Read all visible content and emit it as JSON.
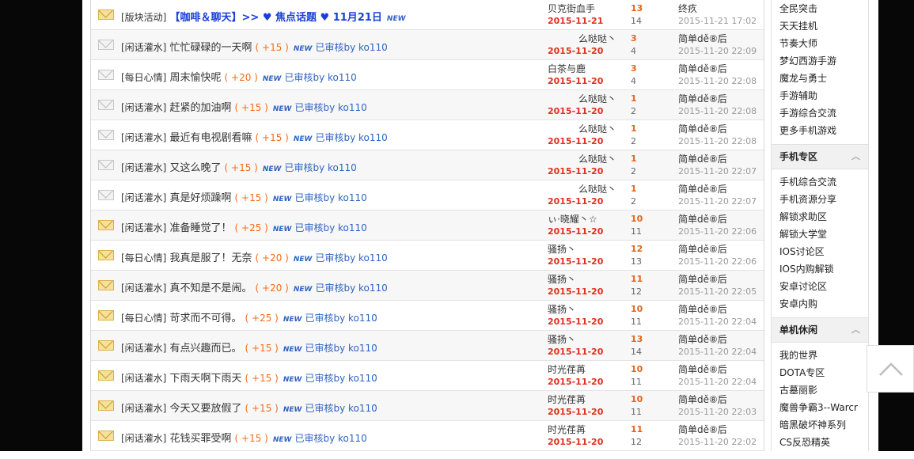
{
  "threads": [
    {
      "icon": "folder-hot-icon",
      "category": "[版块活动]",
      "title_prefix": "【咖啡＆聊天】>> ♥ 焦点话题 ♥ 11月21日",
      "title": "",
      "points": "",
      "new_badge": "NEW",
      "audit": "",
      "author": "贝克街血手",
      "author_date": "2015-11-21",
      "replies": "13",
      "views": "14",
      "last_user": "终疚",
      "last_time": "2015-11-21 17:02",
      "stripe": false,
      "hot": true,
      "author_right": false
    },
    {
      "icon": "folder-icon",
      "category": "[闲话灌水]",
      "title": "忙忙碌碌的一天啊",
      "points": "( +15 )",
      "new_badge": "NEW",
      "audit": "已审核by ko110",
      "author": "么哒哒丶",
      "author_date": "2015-11-20",
      "replies": "3",
      "views": "4",
      "last_user": "简单dě⑧后",
      "last_time": "2015-11-20 22:09",
      "stripe": true,
      "hot": false,
      "author_right": true
    },
    {
      "icon": "folder-icon",
      "category": "[每日心情]",
      "title": "周末愉快呢",
      "points": "( +20 )",
      "new_badge": "NEW",
      "audit": "已审核by ko110",
      "author": "白茶与鹿",
      "author_date": "2015-11-20",
      "replies": "3",
      "views": "4",
      "last_user": "简单dě⑧后",
      "last_time": "2015-11-20 22:08",
      "stripe": false,
      "hot": false,
      "author_right": false
    },
    {
      "icon": "folder-icon",
      "category": "[闲话灌水]",
      "title": "赶紧的加油啊",
      "points": "( +15 )",
      "new_badge": "NEW",
      "audit": "已审核by ko110",
      "author": "么哒哒丶",
      "author_date": "2015-11-20",
      "replies": "1",
      "views": "2",
      "last_user": "简单dě⑧后",
      "last_time": "2015-11-20 22:08",
      "stripe": true,
      "hot": false,
      "author_right": true
    },
    {
      "icon": "folder-icon",
      "category": "[闲话灌水]",
      "title": "最近有电视剧看嘛",
      "points": "( +15 )",
      "new_badge": "NEW",
      "audit": "已审核by ko110",
      "author": "么哒哒丶",
      "author_date": "2015-11-20",
      "replies": "1",
      "views": "2",
      "last_user": "简单dě⑧后",
      "last_time": "2015-11-20 22:08",
      "stripe": false,
      "hot": false,
      "author_right": true
    },
    {
      "icon": "folder-icon",
      "category": "[闲话灌水]",
      "title": "又这么晚了",
      "points": "( +15 )",
      "new_badge": "NEW",
      "audit": "已审核by ko110",
      "author": "么哒哒丶",
      "author_date": "2015-11-20",
      "replies": "1",
      "views": "2",
      "last_user": "简单dě⑧后",
      "last_time": "2015-11-20 22:07",
      "stripe": true,
      "hot": false,
      "author_right": true
    },
    {
      "icon": "folder-icon",
      "category": "[闲话灌水]",
      "title": "真是好烦躁啊",
      "points": "( +15 )",
      "new_badge": "NEW",
      "audit": "已审核by ko110",
      "author": "么哒哒丶",
      "author_date": "2015-11-20",
      "replies": "1",
      "views": "2",
      "last_user": "简单dě⑧后",
      "last_time": "2015-11-20 22:07",
      "stripe": false,
      "hot": false,
      "author_right": true
    },
    {
      "icon": "folder-hot-icon",
      "category": "[闲话灌水]",
      "title": "准备睡觉了！",
      "points": "( +25 )",
      "new_badge": "NEW",
      "audit": "已审核by ko110",
      "author": "ぃ·晓耀丶☆",
      "author_date": "2015-11-20",
      "replies": "10",
      "views": "11",
      "last_user": "简单dě⑧后",
      "last_time": "2015-11-20 22:06",
      "stripe": true,
      "hot": true,
      "author_right": false
    },
    {
      "icon": "folder-hot-icon",
      "category": "[每日心情]",
      "title": "我真是服了！无奈",
      "points": "( +20 )",
      "new_badge": "NEW",
      "audit": "已审核by ko110",
      "author": "骚扬丶",
      "author_date": "2015-11-20",
      "replies": "12",
      "views": "13",
      "last_user": "简单dě⑧后",
      "last_time": "2015-11-20 22:06",
      "stripe": false,
      "hot": true,
      "author_right": false
    },
    {
      "icon": "folder-hot-icon",
      "category": "[闲话灌水]",
      "title": "真不知是不是闹。",
      "points": "( +20 )",
      "new_badge": "NEW",
      "audit": "已审核by ko110",
      "author": "骚扬丶",
      "author_date": "2015-11-20",
      "replies": "11",
      "views": "12",
      "last_user": "简单dě⑧后",
      "last_time": "2015-11-20 22:05",
      "stripe": true,
      "hot": true,
      "author_right": false
    },
    {
      "icon": "folder-hot-icon",
      "category": "[每日心情]",
      "title": "苛求而不可得。",
      "points": "( +25 )",
      "new_badge": "NEW",
      "audit": "已审核by ko110",
      "author": "骚扬丶",
      "author_date": "2015-11-20",
      "replies": "10",
      "views": "11",
      "last_user": "简单dě⑧后",
      "last_time": "2015-11-20 22:04",
      "stripe": false,
      "hot": true,
      "author_right": false
    },
    {
      "icon": "folder-hot-icon",
      "category": "[闲话灌水]",
      "title": "有点兴趣而已。",
      "points": "( +15 )",
      "new_badge": "NEW",
      "audit": "已审核by ko110",
      "author": "骚扬丶",
      "author_date": "2015-11-20",
      "replies": "13",
      "views": "14",
      "last_user": "简单dě⑧后",
      "last_time": "2015-11-20 22:04",
      "stripe": true,
      "hot": true,
      "author_right": false
    },
    {
      "icon": "folder-hot-icon",
      "category": "[闲话灌水]",
      "title": "下雨天啊下雨天",
      "points": "( +15 )",
      "new_badge": "NEW",
      "audit": "已审核by ko110",
      "author": "时光荏苒",
      "author_date": "2015-11-20",
      "replies": "10",
      "views": "11",
      "last_user": "简单dě⑧后",
      "last_time": "2015-11-20 22:04",
      "stripe": false,
      "hot": true,
      "author_right": false
    },
    {
      "icon": "folder-hot-icon",
      "category": "[闲话灌水]",
      "title": "今天又要放假了",
      "points": "( +15 )",
      "new_badge": "NEW",
      "audit": "已审核by ko110",
      "author": "时光荏苒",
      "author_date": "2015-11-20",
      "replies": "10",
      "views": "11",
      "last_user": "简单dě⑧后",
      "last_time": "2015-11-20 22:03",
      "stripe": true,
      "hot": true,
      "author_right": false
    },
    {
      "icon": "folder-hot-icon",
      "category": "[闲话灌水]",
      "title": "花钱买罪受啊",
      "points": "( +15 )",
      "new_badge": "NEW",
      "audit": "已审核by ko110",
      "author": "时光荏苒",
      "author_date": "2015-11-20",
      "replies": "11",
      "views": "12",
      "last_user": "简单dě⑧后",
      "last_time": "2015-11-20 22:02",
      "stripe": false,
      "hot": true,
      "author_right": false
    }
  ],
  "sidebar": {
    "top_items": [
      "全民突击",
      "天天挂机",
      "节奏大师",
      "梦幻西游手游",
      "魔龙与勇士",
      "手游辅助",
      "手游综合交流",
      "更多手机游戏"
    ],
    "sections": [
      {
        "title": "手机专区",
        "chevron_icon": "chevron-up-icon",
        "items": [
          "手机综合交流",
          "手机资源分享",
          "解锁求助区",
          "解锁大学堂",
          "IOS讨论区",
          "IOS内购解锁",
          "安卓讨论区",
          "安卓内购"
        ]
      },
      {
        "title": "单机休闲",
        "chevron_icon": "chevron-up-icon",
        "items": [
          "我的世界",
          "DOTA专区",
          "古墓丽影",
          "魔兽争霸3--Warcr",
          "暗黑破坏神系列",
          "CS反恐精英"
        ]
      }
    ]
  },
  "back_to_top": {
    "icon": "chevron-up-icon"
  },
  "colors": {
    "accent_blue": "#2f64c0",
    "date_red": "#e0301e",
    "reply_orange": "#e0651b",
    "points_orange": "#f26c1b",
    "background": "#070707"
  }
}
